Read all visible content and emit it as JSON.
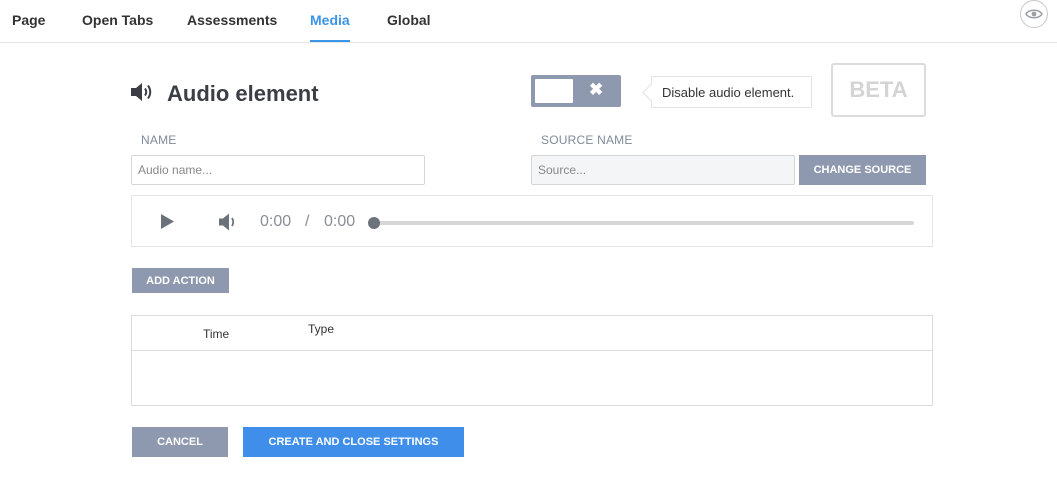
{
  "nav": {
    "tabs": [
      {
        "label": "Page"
      },
      {
        "label": "Open Tabs"
      },
      {
        "label": "Assessments"
      },
      {
        "label": "Media"
      },
      {
        "label": "Global"
      }
    ],
    "active_tab": "Media"
  },
  "header": {
    "title": "Audio element",
    "toggle_state": "off",
    "toggle_icon": "close-icon",
    "tooltip": "Disable audio element.",
    "badge": "BETA"
  },
  "form": {
    "name_label": "NAME",
    "name_placeholder": "Audio name...",
    "name_value": "",
    "source_label": "SOURCE NAME",
    "source_placeholder": "Source...",
    "source_value": "",
    "change_source_button": "CHANGE SOURCE"
  },
  "player": {
    "current_time": "0:00",
    "separator": "/",
    "duration": "0:00",
    "progress": 0
  },
  "actions": {
    "add_action_button": "ADD ACTION"
  },
  "table": {
    "columns": [
      "Time",
      "Type"
    ],
    "rows": []
  },
  "footer": {
    "cancel_button": "CANCEL",
    "create_button": "CREATE AND CLOSE SETTINGS"
  },
  "colors": {
    "accent": "#3a95e6",
    "button_gray": "#8e98ae",
    "button_blue": "#3f8fea"
  }
}
